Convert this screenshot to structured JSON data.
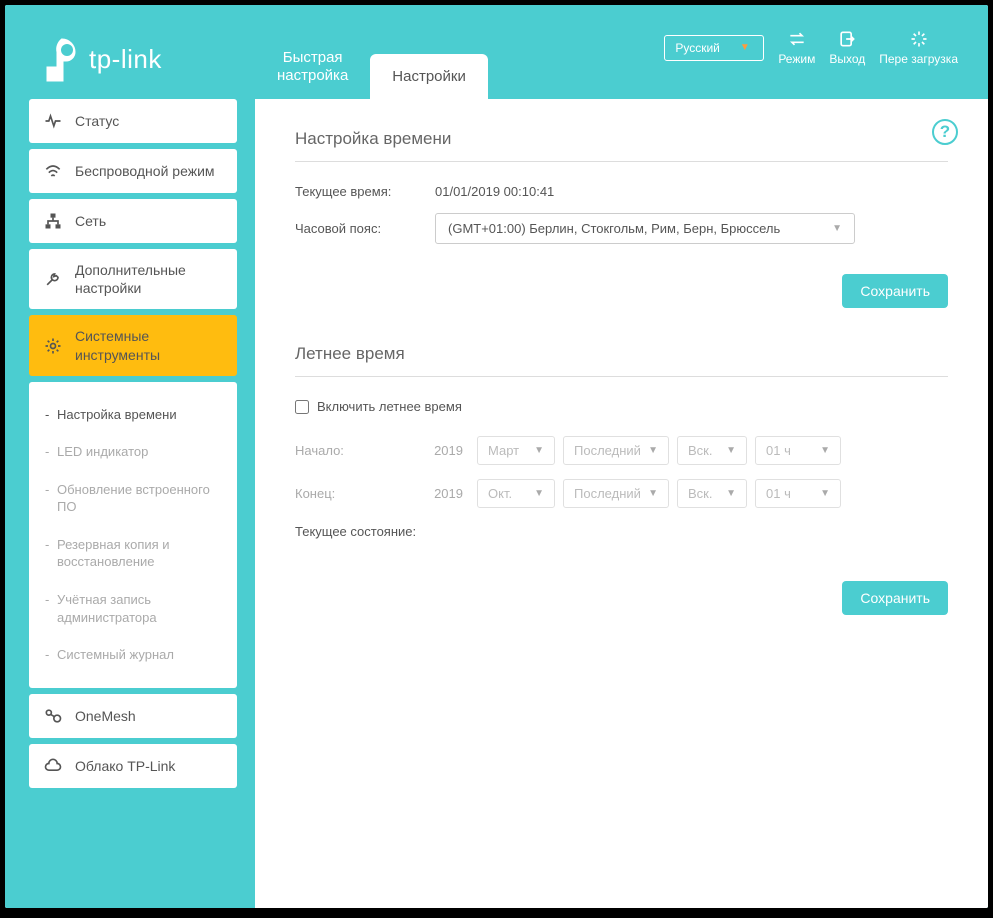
{
  "brand": "tp-link",
  "header": {
    "tabs": {
      "quick": "Быстрая\nнастройка",
      "settings": "Настройки"
    },
    "language": "Русский",
    "buttons": {
      "mode": "Режим",
      "logout": "Выход",
      "reboot": "Пере загрузка"
    }
  },
  "sidebar": {
    "status": "Статус",
    "wireless": "Беспроводной режим",
    "network": "Сеть",
    "advanced": "Дополнительные настройки",
    "system": "Системные инструменты",
    "onemesh": "OneMesh",
    "cloud": "Облако TP-Link",
    "sub": {
      "time": "Настройка времени",
      "led": "LED индикатор",
      "firmware": "Обновление встроенного ПО",
      "backup": "Резервная копия и восстановление",
      "admin": "Учётная запись администратора",
      "syslog": "Системный журнал"
    }
  },
  "content": {
    "section1_title": "Настройка времени",
    "current_time_label": "Текущее время:",
    "current_time_value": "01/01/2019 00:10:41",
    "timezone_label": "Часовой пояс:",
    "timezone_value": "(GMT+01:00) Берлин, Стокгольм, Рим, Берн, Брюссель",
    "save": "Сохранить",
    "section2_title": "Летнее время",
    "enable_dst": "Включить летнее время",
    "start_label": "Начало:",
    "end_label": "Конец:",
    "year": "2019",
    "start": {
      "month": "Март",
      "week": "Последний",
      "day": "Вск.",
      "hour": "01 ч"
    },
    "end": {
      "month": "Окт.",
      "week": "Последний",
      "day": "Вск.",
      "hour": "01 ч"
    },
    "status_label": "Текущее состояние:"
  }
}
